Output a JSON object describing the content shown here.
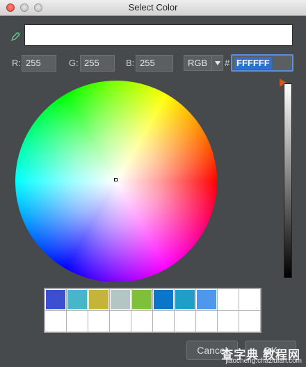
{
  "window": {
    "title": "Select Color"
  },
  "fields": {
    "r_label": "R:",
    "r_value": "255",
    "g_label": "G:",
    "g_value": "255",
    "b_label": "B:",
    "b_value": "255",
    "mode_value": "RGB",
    "hex_prefix": "#",
    "hex_value": "FFFFFF"
  },
  "preview": {
    "color": "#FFFFFF"
  },
  "brightness": {
    "level": 1.0
  },
  "swatches": [
    "#3b4fd1",
    "#49b5c8",
    "#c4b43a",
    "#b4c6c3",
    "#7ec03a",
    "#0b76c9",
    "#1e9fc8",
    "#4f97ec",
    "#ffffff",
    "#ffffff",
    "#ffffff",
    "#ffffff",
    "#ffffff",
    "#ffffff",
    "#ffffff",
    "#ffffff",
    "#ffffff",
    "#ffffff",
    "#ffffff",
    "#ffffff"
  ],
  "buttons": {
    "cancel_label": "Cancel",
    "ok_label": "OK"
  },
  "watermark": {
    "main": "查字典 教程网",
    "sub": "jiaocheng.chazidian.com"
  },
  "icons": [
    "eyedropper-icon",
    "dropdown-arrow-icon"
  ]
}
